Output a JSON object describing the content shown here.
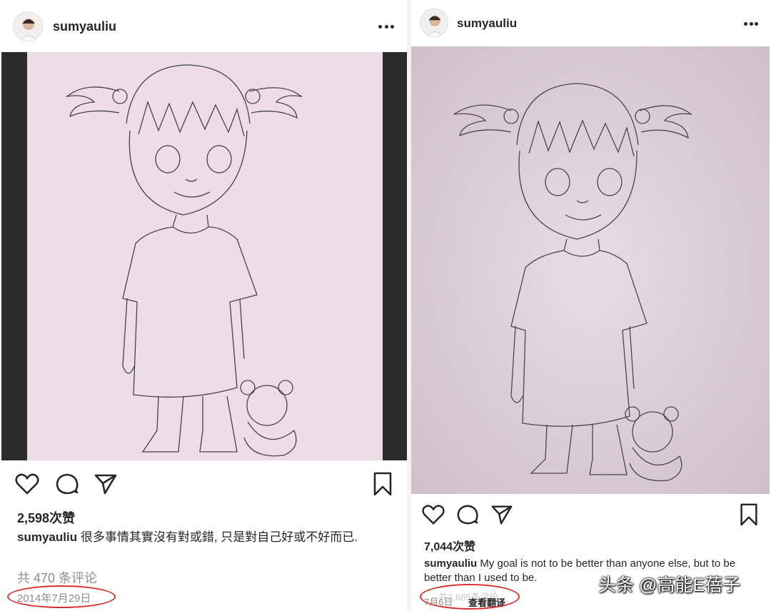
{
  "left_post": {
    "username": "sumyauliu",
    "likes": "2,598次赞",
    "caption_user": "sumyauliu",
    "caption_text": "很多事情其實沒有對或錯, 只是對自己好或不好而已.",
    "comments": "共 470 条评论",
    "date": "2014年7月29日"
  },
  "right_post": {
    "username": "sumyauliu",
    "likes": "7,044次赞",
    "caption_user": "sumyauliu",
    "caption_text": "My goal is not to be better than anyone else, but to be better than I used to be.",
    "comments": "共2,685条评论",
    "date": "7月6日",
    "translate": "查看翻译"
  },
  "watermark": "头条 @高能E蓓子",
  "icons": [
    "avatar",
    "more-icon",
    "heart-icon",
    "comment-icon",
    "share-icon",
    "bookmark-icon"
  ],
  "colors": {
    "highlight_ring": "#d9302e",
    "text": "#262626",
    "muted": "#8e8e8e"
  }
}
